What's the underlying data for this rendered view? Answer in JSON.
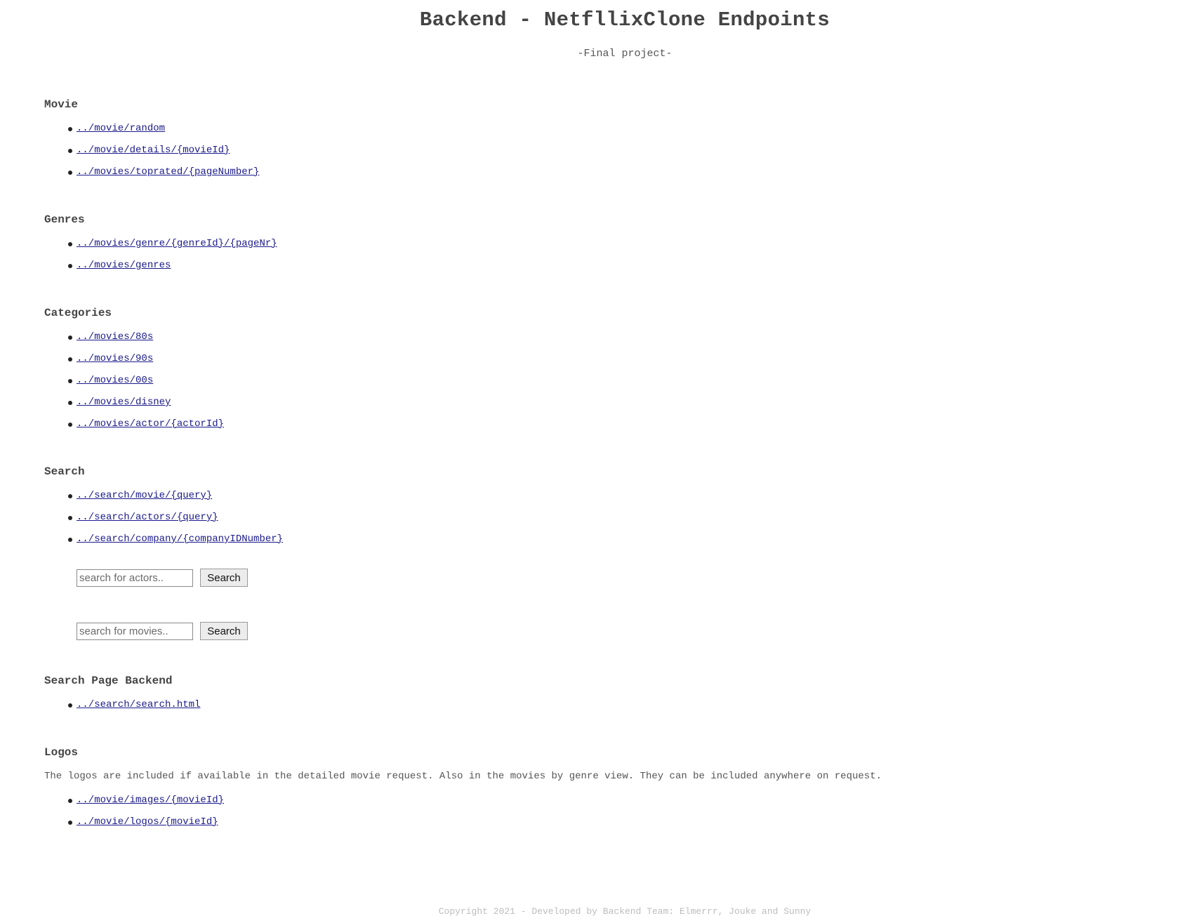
{
  "header": {
    "title": "Backend - NetfllixClone Endpoints",
    "subtitle": "-Final project-"
  },
  "sections": {
    "movie": {
      "heading": "Movie",
      "links": [
        "../movie/random",
        "../movie/details/{movieId}",
        "../movies/toprated/{pageNumber}"
      ]
    },
    "genres": {
      "heading": "Genres",
      "links": [
        "../movies/genre/{genreId}/{pageNr}",
        "../movies/genres"
      ]
    },
    "categories": {
      "heading": "Categories",
      "links": [
        "../movies/80s",
        "../movies/90s",
        "../movies/00s",
        "../movies/disney",
        "../movies/actor/{actorId}"
      ]
    },
    "search": {
      "heading": "Search",
      "links": [
        "../search/movie/{query}",
        "../search/actors/{query}",
        "../search/company/{companyIDNumber}"
      ]
    },
    "search_page": {
      "heading": "Search Page Backend",
      "links": [
        "../search/search.html"
      ]
    },
    "logos": {
      "heading": "Logos",
      "description": "The logos are included if available in the detailed movie request. Also in the movies by genre view. They can be included anywhere on request.",
      "links": [
        "../movie/images/{movieId}",
        "../movie/logos/{movieId}"
      ]
    }
  },
  "search_forms": {
    "actors": {
      "placeholder": "search for actors..",
      "value": "",
      "button_label": "Search"
    },
    "movies": {
      "placeholder": "search for movies..",
      "value": "",
      "button_label": "Search"
    }
  },
  "footer": {
    "text": "Copyright 2021 - Developed by Backend Team: Elmerrr, Jouke and Sunny"
  },
  "colors": {
    "link": "#1a1a8c",
    "text": "#444444",
    "footer": "#bdbdbd"
  }
}
